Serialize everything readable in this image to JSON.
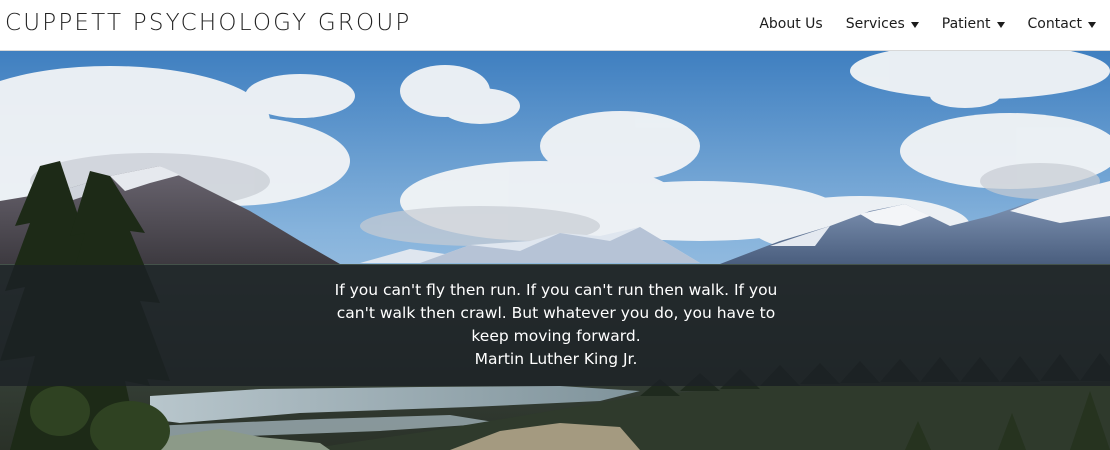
{
  "header": {
    "brand": "CUPPETT PSYCHOLOGY GROUP",
    "nav": [
      {
        "label": "About Us",
        "has_dropdown": false
      },
      {
        "label": "Services",
        "has_dropdown": true
      },
      {
        "label": "Patient",
        "has_dropdown": true
      },
      {
        "label": "Contact",
        "has_dropdown": true
      }
    ]
  },
  "hero": {
    "quote": "If you can't fly then run. If you can't run then walk. If you can't walk then crawl. But whatever you do, you have to keep moving forward.",
    "author": "Martin Luther King Jr."
  },
  "colors": {
    "header_bg": "#ffffff",
    "nav_text": "#1c1c1c",
    "quote_band": "rgba(28,32,38,0.80)",
    "quote_text": "#ffffff"
  }
}
